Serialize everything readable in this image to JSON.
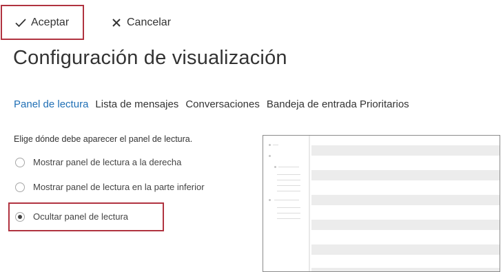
{
  "toolbar": {
    "accept_label": "Aceptar",
    "cancel_label": "Cancelar",
    "accept_icon": "checkmark-icon",
    "cancel_icon": "close-icon"
  },
  "page": {
    "title": "Configuración de visualización"
  },
  "tabs": [
    {
      "label": "Panel de lectura",
      "active": true
    },
    {
      "label": "Lista de mensajes",
      "active": false
    },
    {
      "label": "Conversaciones",
      "active": false
    },
    {
      "label": "Bandeja de entrada Prioritarios",
      "active": false
    }
  ],
  "reading_pane": {
    "prompt": "Elige dónde debe aparecer el panel de lectura.",
    "options": [
      {
        "label": "Mostrar panel de lectura a la derecha",
        "selected": false
      },
      {
        "label": "Mostrar panel de lectura en la parte inferior",
        "selected": false
      },
      {
        "label": "Ocultar panel de lectura",
        "selected": true
      }
    ]
  },
  "colors": {
    "accent": "#1f6fb5",
    "highlight_border": "#b0323f"
  }
}
